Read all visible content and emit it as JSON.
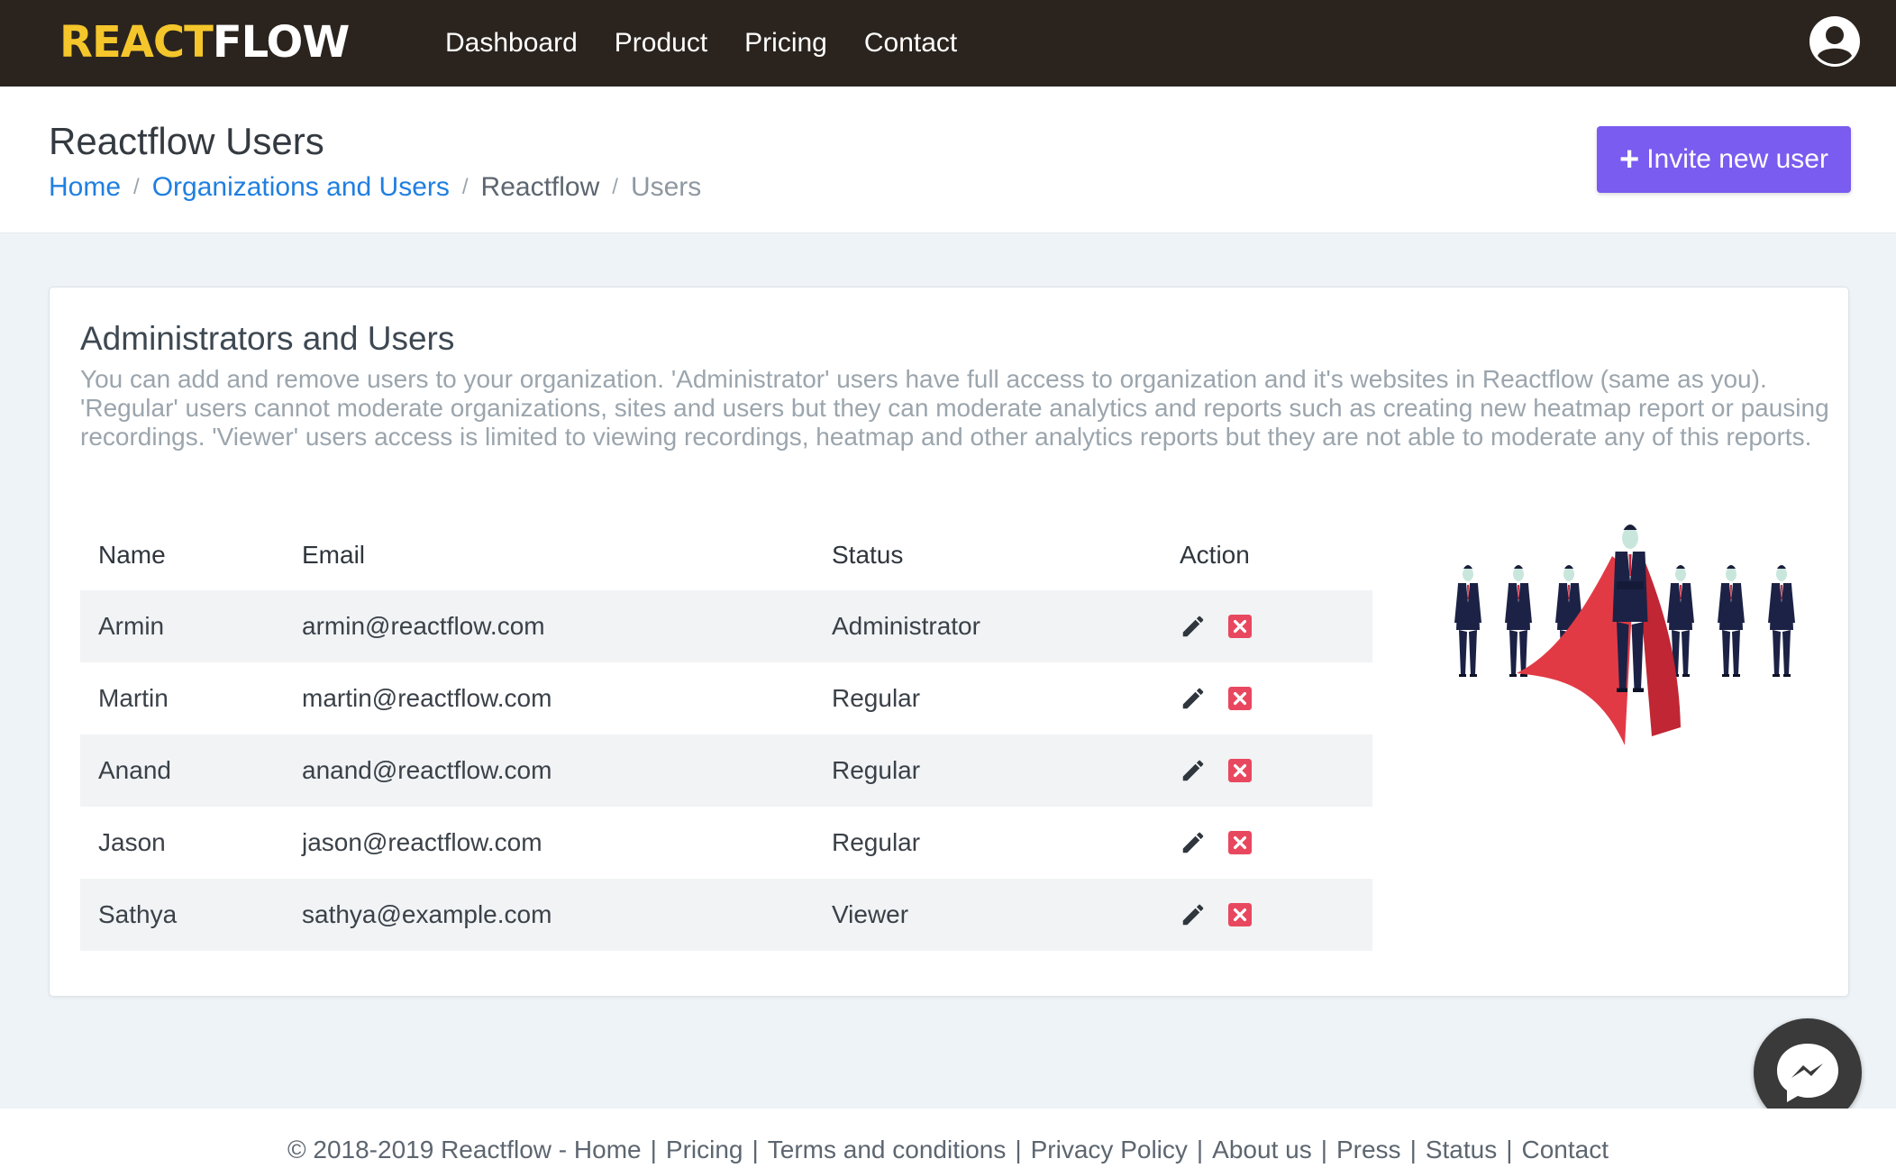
{
  "navbar": {
    "logo_part1": "REACT",
    "logo_part2": "FLOW",
    "links": [
      "Dashboard",
      "Product",
      "Pricing",
      "Contact"
    ],
    "user_icon": "user-circle-icon"
  },
  "header": {
    "title": "Reactflow Users",
    "breadcrumb": [
      "Home",
      "Organizations and Users",
      "Reactflow",
      "Users"
    ],
    "invite_label": "Invite new user"
  },
  "card": {
    "title": "Administrators and Users",
    "description": "You can add and remove users to your organization. 'Administrator' users have full access to organization and it's websites in Reactflow (same as you). 'Regular' users cannot moderate organizations, sites and users but they can moderate analytics and reports such as creating new heatmap report or pausing recordings. 'Viewer' users access is limited to viewing recordings, heatmap and other analytics reports but they are not able to moderate any of this reports.",
    "table": {
      "headers": [
        "Name",
        "Email",
        "Status",
        "Action"
      ],
      "rows": [
        {
          "name": "Armin",
          "email": "armin@reactflow.com",
          "status": "Administrator"
        },
        {
          "name": "Martin",
          "email": "martin@reactflow.com",
          "status": "Regular"
        },
        {
          "name": "Anand",
          "email": "anand@reactflow.com",
          "status": "Regular"
        },
        {
          "name": "Jason",
          "email": "jason@reactflow.com",
          "status": "Regular"
        },
        {
          "name": "Sathya",
          "email": "sathya@example.com",
          "status": "Viewer"
        }
      ]
    }
  },
  "footer": {
    "copyright": "© 2018-2019 Reactflow - ",
    "links": [
      "Home",
      "Pricing",
      "Terms and conditions",
      "Privacy Policy",
      "About us",
      "Press",
      "Status",
      "Contact"
    ]
  },
  "colors": {
    "navbar": "#2b241e",
    "logo_accent": "#f5c62b",
    "primary_button": "#7a5cf0",
    "link": "#1f7fe0",
    "delete": "#e8485f"
  }
}
